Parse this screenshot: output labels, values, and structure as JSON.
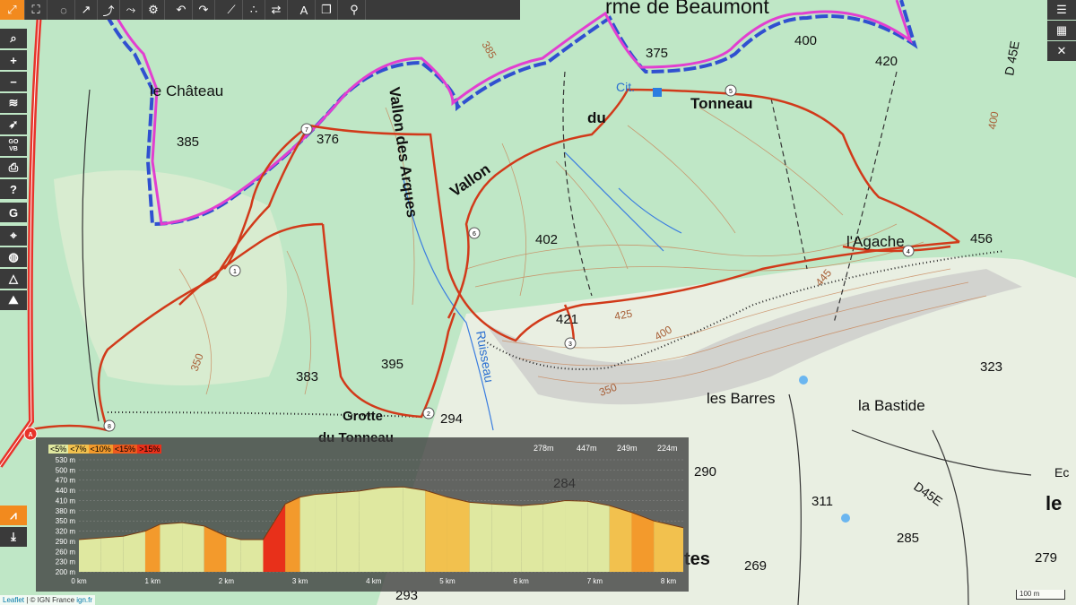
{
  "toolbar": {
    "buttons": [
      "expand-icon",
      "fit-bounds-icon",
      "hide-icon",
      "segment-icon",
      "draw-icon",
      "route-icon",
      "bike-icon",
      "undo-icon",
      "redo-icon",
      "node-icon",
      "nodes-icon",
      "reverse-icon",
      "translate-icon",
      "copy-icon",
      "marker-icon"
    ]
  },
  "left_controls": {
    "buttons": [
      "search-icon",
      "zoom-in-icon",
      "zoom-out-icon",
      "layers-icon",
      "locate-icon",
      "print-icon",
      "help-icon",
      "google-icon",
      "crosshair-icon",
      "globe-icon",
      "peak-icon",
      "mountain-icon",
      "elevation-icon",
      "download-icon"
    ],
    "go_label": "GO\nVB"
  },
  "right_controls": {
    "buttons": [
      "menu-icon",
      "grid-icon",
      "close-icon"
    ]
  },
  "map_labels": [
    {
      "text": "le Château",
      "kind": "place"
    },
    {
      "text": "385",
      "kind": "alt"
    },
    {
      "text": "376",
      "kind": "alt"
    },
    {
      "text": "383",
      "kind": "alt"
    },
    {
      "text": "395",
      "kind": "alt"
    },
    {
      "text": "294",
      "kind": "alt"
    },
    {
      "text": "402",
      "kind": "alt"
    },
    {
      "text": "421",
      "kind": "alt"
    },
    {
      "text": "375",
      "kind": "alt"
    },
    {
      "text": "400",
      "kind": "alt"
    },
    {
      "text": "420",
      "kind": "alt"
    },
    {
      "text": "456",
      "kind": "alt"
    },
    {
      "text": "323",
      "kind": "alt"
    },
    {
      "text": "290",
      "kind": "alt"
    },
    {
      "text": "284",
      "kind": "alt"
    },
    {
      "text": "311",
      "kind": "alt"
    },
    {
      "text": "285",
      "kind": "alt"
    },
    {
      "text": "269",
      "kind": "alt"
    },
    {
      "text": "279",
      "kind": "alt"
    },
    {
      "text": "293",
      "kind": "alt"
    },
    {
      "text": "Vallon des Arques",
      "kind": "valley"
    },
    {
      "text": "Vallon",
      "kind": "valley"
    },
    {
      "text": "du",
      "kind": "valley"
    },
    {
      "text": "Tonneau",
      "kind": "valley"
    },
    {
      "text": "Grotte",
      "kind": "place"
    },
    {
      "text": "du Tonneau",
      "kind": "place"
    },
    {
      "text": "Ruisseau",
      "kind": "water"
    },
    {
      "text": "l'Agache",
      "kind": "place"
    },
    {
      "text": "les Barres",
      "kind": "place"
    },
    {
      "text": "la Bastide",
      "kind": "place"
    },
    {
      "text": "rme de Beaumont",
      "kind": "place"
    },
    {
      "text": "Cit.",
      "kind": "place"
    },
    {
      "text": "D 45E",
      "kind": "road"
    },
    {
      "text": "D45E",
      "kind": "road"
    },
    {
      "text": "le",
      "kind": "place"
    },
    {
      "text": "tes",
      "kind": "place"
    },
    {
      "text": "425",
      "kind": "contour"
    },
    {
      "text": "400",
      "kind": "contour"
    },
    {
      "text": "350",
      "kind": "contour"
    },
    {
      "text": "445",
      "kind": "contour"
    },
    {
      "text": "385",
      "kind": "contour"
    },
    {
      "text": "400",
      "kind": "contour"
    },
    {
      "text": "350",
      "kind": "contour"
    },
    {
      "text": "Ec",
      "kind": "place"
    }
  ],
  "waypoints": [
    "A",
    "1",
    "2",
    "3",
    "4",
    "5",
    "6",
    "7",
    "8"
  ],
  "elevation_profile": {
    "legend": [
      {
        "label": "<5%",
        "color": "#dfe8a0"
      },
      {
        "label": "<7%",
        "color": "#f2c14e"
      },
      {
        "label": "<10%",
        "color": "#f39a2c"
      },
      {
        "label": "<15%",
        "color": "#ee5a1e"
      },
      {
        "label": ">15%",
        "color": "#e8301a"
      }
    ],
    "segment_distances": [
      "278m",
      "447m",
      "249m",
      "224m"
    ],
    "y_ticks": [
      "530 m",
      "500 m",
      "470 m",
      "440 m",
      "410 m",
      "380 m",
      "350 m",
      "320 m",
      "290 m",
      "260 m",
      "230 m",
      "200 m"
    ],
    "x_ticks": [
      "0 km",
      "1 km",
      "2 km",
      "3 km",
      "4 km",
      "5 km",
      "6 km",
      "7 km",
      "8 km"
    ],
    "ylim": [
      200,
      530
    ],
    "xlim_km": [
      0,
      8.2
    ],
    "profile_km": [
      0,
      0.3,
      0.6,
      0.9,
      1.1,
      1.4,
      1.7,
      2.0,
      2.2,
      2.5,
      2.8,
      3.0,
      3.2,
      3.5,
      3.8,
      4.1,
      4.4,
      4.7,
      5.0,
      5.3,
      5.6,
      6.0,
      6.3,
      6.6,
      6.9,
      7.2,
      7.5,
      7.8,
      8.2
    ],
    "profile_m": [
      295,
      300,
      305,
      320,
      340,
      345,
      335,
      305,
      295,
      295,
      400,
      420,
      428,
      433,
      438,
      448,
      450,
      440,
      420,
      405,
      400,
      395,
      400,
      410,
      408,
      395,
      375,
      350,
      330
    ]
  },
  "attribution": {
    "leaflet": "Leaflet",
    "sep": " | © IGN France ",
    "ign": "ign.fr"
  },
  "scale_label": "100 m"
}
